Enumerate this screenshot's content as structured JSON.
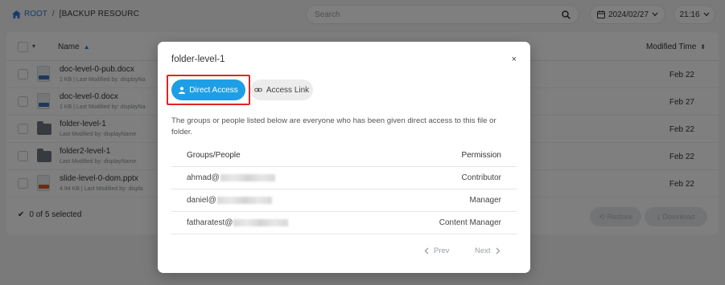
{
  "breadcrumb": {
    "root": "ROOT",
    "separator": "/",
    "path": "[BACKUP RESOURC"
  },
  "search": {
    "placeholder": "Search"
  },
  "date_filter": {
    "value": "2024/02/27"
  },
  "time_filter": {
    "value": "21:16"
  },
  "table": {
    "columns": {
      "name": "Name",
      "modified": "Modified Time"
    },
    "rows": [
      {
        "name": "doc-level-0-pub.docx",
        "meta": "1 KB | Last Modified by: displayNa",
        "date": "Feb 22",
        "kind": "docx"
      },
      {
        "name": "doc-level-0.docx",
        "meta": "1 KB | Last Modified by: displayNa",
        "date": "Feb 27",
        "kind": "docx"
      },
      {
        "name": "folder-level-1",
        "meta": "Last Modified by: displayName",
        "date": "Feb 22",
        "kind": "folder"
      },
      {
        "name": "folder2-level-1",
        "meta": "Last Modified by: displayName",
        "date": "Feb 22",
        "kind": "folder"
      },
      {
        "name": "slide-level-0-dom.pptx",
        "meta": "4.94 KB | Last Modified by: displa",
        "date": "Feb 22",
        "kind": "pptx"
      }
    ],
    "selection": "0 of 5 selected",
    "restore_label": "Restore",
    "download_label": "Download"
  },
  "modal": {
    "title": "folder-level-1",
    "close_glyph": "×",
    "tabs": [
      {
        "label": "Direct Access",
        "active": true
      },
      {
        "label": "Access Link",
        "active": false
      }
    ],
    "description": "The groups or people listed below are everyone who has been given direct access to this file or folder.",
    "columns": {
      "who": "Groups/People",
      "permission": "Permission"
    },
    "rows": [
      {
        "who": "ahmad@",
        "permission": "Contributor"
      },
      {
        "who": "daniel@",
        "permission": "Manager"
      },
      {
        "who": "fatharatest@",
        "permission": "Content Manager"
      }
    ],
    "pager": {
      "prev": "Prev",
      "next": "Next"
    }
  },
  "colors": {
    "accent": "#1e9fe5",
    "highlight": "#e02424",
    "link": "#2b7bd6"
  }
}
